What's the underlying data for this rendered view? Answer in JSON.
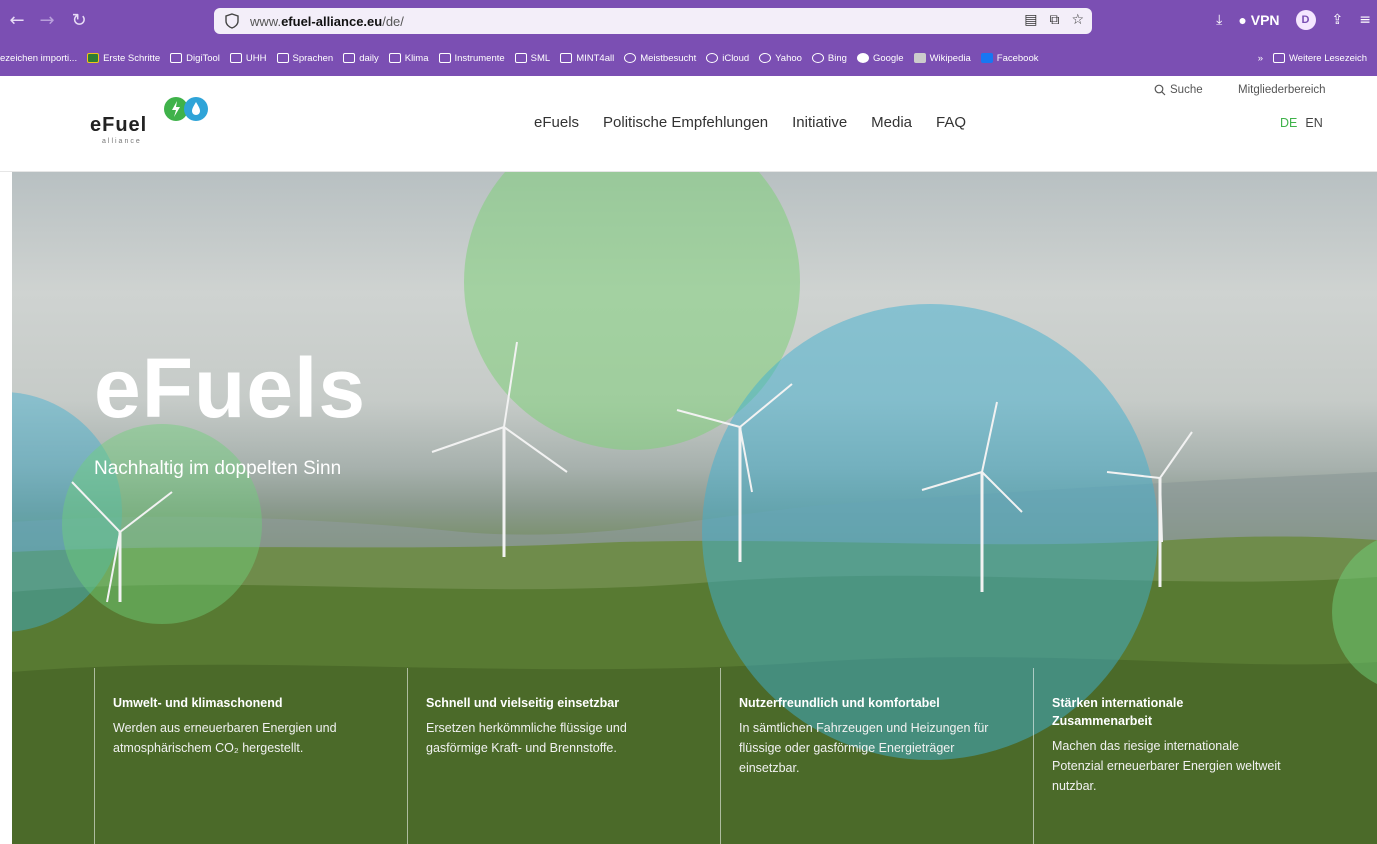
{
  "browser": {
    "url_prefix": "www.",
    "url_domain": "efuel-alliance.eu",
    "url_path": "/de/",
    "vpn_label": "VPN",
    "profile_initial": "D"
  },
  "bookmarks": [
    {
      "label": "ezeichen importi..."
    },
    {
      "label": "Erste Schritte"
    },
    {
      "label": "DigiTool"
    },
    {
      "label": "UHH"
    },
    {
      "label": "Sprachen"
    },
    {
      "label": "daily"
    },
    {
      "label": "Klima"
    },
    {
      "label": "Instrumente"
    },
    {
      "label": "SML"
    },
    {
      "label": "MINT4all"
    },
    {
      "label": "Meistbesucht"
    },
    {
      "label": "iCloud"
    },
    {
      "label": "Yahoo"
    },
    {
      "label": "Bing"
    },
    {
      "label": "Google"
    },
    {
      "label": "Wikipedia"
    },
    {
      "label": "Facebook"
    }
  ],
  "bookmarks_more": "Weitere Lesezeich",
  "site": {
    "logo_text": "eFuel",
    "logo_sub": "alliance",
    "nav": [
      "eFuels",
      "Politische Empfehlungen",
      "Initiative",
      "Media",
      "FAQ"
    ],
    "search_label": "Suche",
    "members_label": "Mitgliederbereich",
    "lang_de": "DE",
    "lang_en": "EN",
    "accent_green": "#3fb24a",
    "accent_blue": "#2fa4d8"
  },
  "hero": {
    "title": "eFuels",
    "subtitle": "Nachhaltig im doppelten Sinn",
    "features": [
      {
        "title": "Umwelt- und klimaschonend",
        "text": "Werden aus erneuerbaren Energien und atmosphärischem CO₂ hergestellt."
      },
      {
        "title": "Schnell und vielseitig einsetzbar",
        "text": "Ersetzen herkömmliche flüssige und gasförmige Kraft- und Brennstoffe."
      },
      {
        "title": "Nutzerfreundlich und komfortabel",
        "text": "In sämtlichen Fahrzeugen und Heizungen für flüssige oder gasförmige Energieträger einsetzbar."
      },
      {
        "title": "Stärken internationale Zusammenarbeit",
        "text": "Machen das riesige internationale Potenzial erneuerbarer Energien weltweit nutzbar."
      }
    ]
  }
}
